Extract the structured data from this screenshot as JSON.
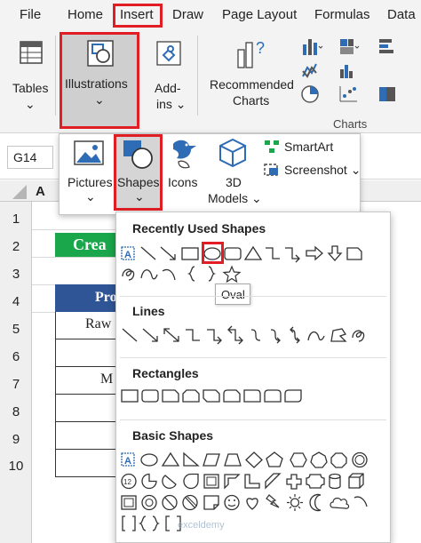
{
  "menu": {
    "tabs": [
      "File",
      "Home",
      "Insert",
      "Draw",
      "Page Layout",
      "Formulas",
      "Data"
    ]
  },
  "ribbon": {
    "tables_label": "Tables",
    "tables_arrow": "⌄",
    "illustrations_label": "Illustrations",
    "illustrations_arrow": "⌄",
    "addins_label_1": "Add-",
    "addins_label_2": "ins ⌄",
    "recommended_label_1": "Recommended",
    "recommended_label_2": "Charts",
    "charts_group_label": "Charts"
  },
  "name_box": {
    "value": "G14"
  },
  "sheet": {
    "col_header": "A",
    "rows": [
      "1",
      "2",
      "3",
      "4",
      "5",
      "6",
      "7",
      "8",
      "9",
      "10"
    ],
    "title_cell": "Crea",
    "header_cell": "Pro",
    "cells": [
      "Raw",
      "",
      "M",
      "",
      ""
    ]
  },
  "illustrations_menu": {
    "pictures_label": "Pictures",
    "pictures_arrow": "⌄",
    "shapes_label": "Shapes",
    "shapes_arrow": "⌄",
    "icons_label": "Icons",
    "models_label_1": "3D",
    "models_label_2": "Models ⌄",
    "smartart_label": "SmartArt",
    "screenshot_label": "Screenshot ⌄"
  },
  "shapes_gallery": {
    "recently_used_title": "Recently Used Shapes",
    "lines_title": "Lines",
    "rectangles_title": "Rectangles",
    "basic_shapes_title": "Basic Shapes",
    "tooltip": "Oval",
    "textbox_glyph": "A",
    "octagon_num": "12"
  },
  "watermark": "exceldemy",
  "colors": {
    "accent_red": "#e01e24",
    "title_green": "#1aa64b",
    "header_blue": "#2f5597",
    "icon_blue": "#2e6cb5"
  }
}
